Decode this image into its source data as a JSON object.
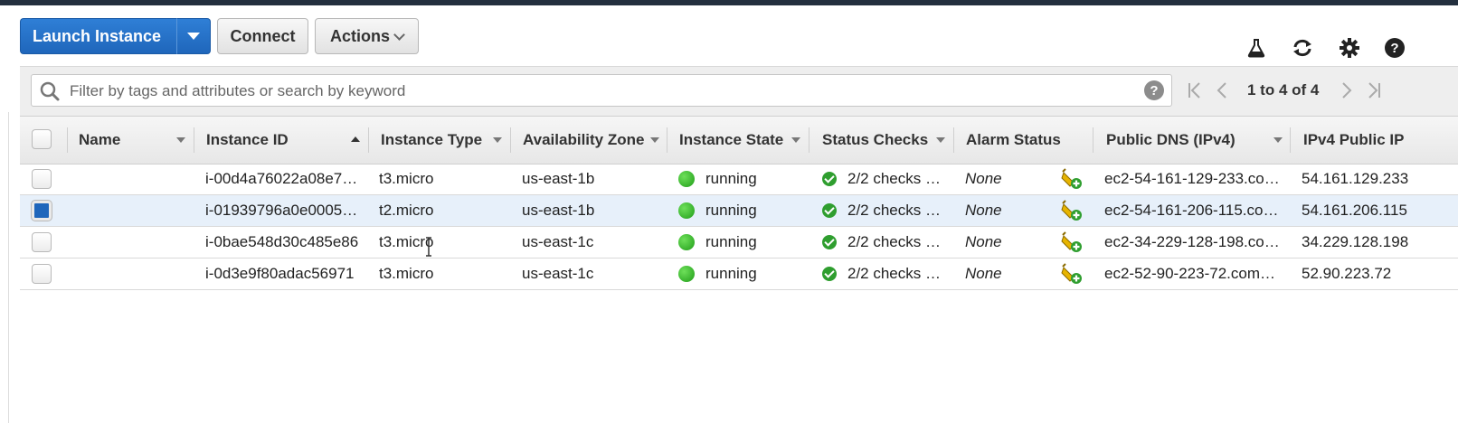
{
  "toolbar": {
    "launch_label": "Launch Instance",
    "connect_label": "Connect",
    "actions_label": "Actions"
  },
  "right_icons": [
    "flask-icon",
    "refresh-icon",
    "gear-icon",
    "help-icon"
  ],
  "filter": {
    "placeholder": "Filter by tags and attributes or search by keyword",
    "help_glyph": "?"
  },
  "pagination": {
    "text": "1 to 4 of 4"
  },
  "table": {
    "headers": {
      "name": "Name",
      "instance_id": "Instance ID",
      "instance_type": "Instance Type",
      "az": "Availability Zone",
      "state": "Instance State",
      "status": "Status Checks",
      "alarm": "Alarm Status",
      "dns": "Public DNS (IPv4)",
      "ip": "IPv4 Public IP"
    },
    "rows": [
      {
        "selected": false,
        "name": "",
        "instance_id": "i-00d4a76022a08e7…",
        "instance_type": "t3.micro",
        "az": "us-east-1b",
        "state": "running",
        "status": "2/2 checks …",
        "alarm": "None",
        "dns": "ec2-54-161-129-233.co…",
        "ip": "54.161.129.233"
      },
      {
        "selected": true,
        "name": "",
        "instance_id": "i-01939796a0e0005…",
        "instance_type": "t2.micro",
        "az": "us-east-1b",
        "state": "running",
        "status": "2/2 checks …",
        "alarm": "None",
        "dns": "ec2-54-161-206-115.co…",
        "ip": "54.161.206.115"
      },
      {
        "selected": false,
        "name": "",
        "instance_id": "i-0bae548d30c485e86",
        "instance_type": "t3.micro",
        "az": "us-east-1c",
        "state": "running",
        "status": "2/2 checks …",
        "alarm": "None",
        "dns": "ec2-34-229-128-198.co…",
        "ip": "34.229.128.198"
      },
      {
        "selected": false,
        "name": "",
        "instance_id": "i-0d3e9f80adac56971",
        "instance_type": "t3.micro",
        "az": "us-east-1c",
        "state": "running",
        "status": "2/2 checks …",
        "alarm": "None",
        "dns": "ec2-52-90-223-72.com…",
        "ip": "52.90.223.72"
      }
    ]
  },
  "colors": {
    "primary_button": "#1f66bb",
    "running_green": "#2fae24",
    "top_bar": "#232f3e"
  }
}
